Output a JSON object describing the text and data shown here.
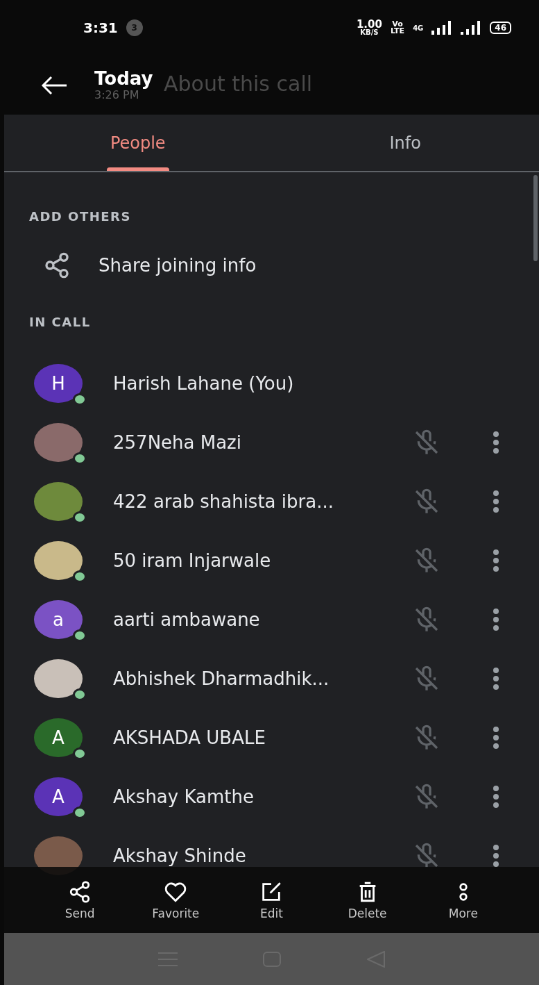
{
  "status_bar": {
    "time": "3:31",
    "notification_count": "3",
    "speed": "1.00",
    "speed_unit": "KB/S",
    "volte": "Vo",
    "volte_sub": "LTE",
    "network": "4G",
    "battery": "46"
  },
  "header": {
    "title": "Today",
    "subtitle": "3:26 PM",
    "faded_title": "About this call"
  },
  "tabs": [
    {
      "label": "People",
      "selected": true
    },
    {
      "label": "Info",
      "selected": false
    }
  ],
  "add_others": {
    "heading": "ADD OTHERS",
    "action": "Share joining info"
  },
  "in_call": {
    "heading": "IN CALL",
    "participants": [
      {
        "name": "Harish Lahane (You)",
        "photo": false,
        "initial": "H",
        "color": "#5b33b6",
        "kind": "self",
        "online": true
      },
      {
        "name": "257Neha Mazi",
        "photo": true,
        "kind": "other",
        "online": true
      },
      {
        "name": "422 arab shahista ibra...",
        "photo": true,
        "kind": "other",
        "online": true
      },
      {
        "name": "50 iram Injarwale",
        "photo": true,
        "kind": "other",
        "online": true
      },
      {
        "name": "aarti ambawane",
        "photo": false,
        "initial": "a",
        "color": "#7b52c4",
        "kind": "other",
        "online": true
      },
      {
        "name": "Abhishek Dharmadhik...",
        "photo": true,
        "kind": "other",
        "online": true
      },
      {
        "name": "AKSHADA UBALE",
        "photo": false,
        "initial": "A",
        "color": "#2a6a2a",
        "kind": "other",
        "online": true
      },
      {
        "name": "Akshay Kamthe",
        "photo": false,
        "initial": "A",
        "color": "#5b33b6",
        "kind": "other",
        "online": true
      },
      {
        "name": "Akshay Shinde",
        "photo": true,
        "kind": "other",
        "online": false
      }
    ]
  },
  "action_bar": [
    {
      "label": "Send",
      "kind": "share"
    },
    {
      "label": "Favorite",
      "kind": "heart"
    },
    {
      "label": "Edit",
      "kind": "edit"
    },
    {
      "label": "Delete",
      "kind": "trash"
    },
    {
      "label": "More",
      "kind": "more"
    }
  ]
}
